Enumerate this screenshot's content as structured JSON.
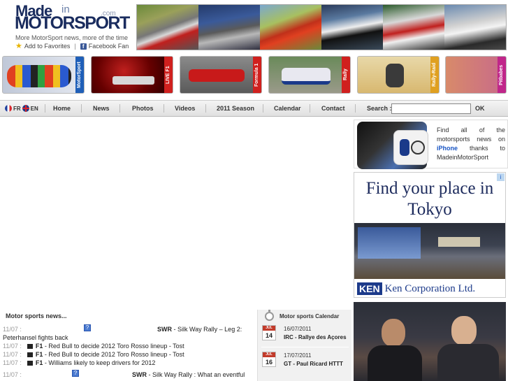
{
  "header": {
    "logo_made": "Made",
    "logo_in": "in",
    "logo_motorsport": "MOTORSPORT",
    "logo_com": ".com",
    "tagline": "More MotorSport news, more of the time",
    "add_favorites": "Add to Favorites",
    "facebook": "Facebook Fan"
  },
  "categories": [
    {
      "label": "MotorSport",
      "color": "#1f5fb8"
    },
    {
      "label": "LIVE F1",
      "color": "#d0201e"
    },
    {
      "label": "Formula 1",
      "color": "#d0201e"
    },
    {
      "label": "Rally",
      "color": "#d0201e"
    },
    {
      "label": "Rally-Raid",
      "color": "#e08a1c"
    },
    {
      "label": "Pitbabes",
      "color": "#c0268a"
    }
  ],
  "nav": {
    "lang_fr": "FR",
    "lang_en": "EN",
    "home": "Home",
    "news": "News",
    "photos": "Photos",
    "videos": "Videos",
    "season": "2011 Season",
    "calendar": "Calendar",
    "contact": "Contact",
    "search_label": "Search :",
    "search_value": "",
    "ok": "OK"
  },
  "iphone_promo": {
    "text_before": "Find all of the motorsports news on",
    "iphone": "iPhone",
    "text_after": "thanks to MadeinMotorSport"
  },
  "ken_ad": {
    "headline": "Find your place in Tokyo",
    "badge": "KEN",
    "company": "Ken Corporation Ltd.",
    "corner": "i"
  },
  "news": {
    "title": "Motor sports news...",
    "items": [
      {
        "date": "11/07 :",
        "cat": "SWR",
        "text": " - Silk Way Rally – Leg 2:",
        "second_line": "Peterhansel fights back",
        "icon": true
      },
      {
        "date": "11/07 :",
        "cat": "F1",
        "text": " - Red Bull to decide 2012 Toro Rosso lineup - Tost",
        "icon": false
      },
      {
        "date": "11/07 :",
        "cat": "F1",
        "text": " - Red Bull to decide 2012 Toro Rosso lineup - Tost",
        "icon": false
      },
      {
        "date": "11/07 :",
        "cat": "F1",
        "text": " - Williams likely to keep drivers for 2012",
        "icon": false
      },
      {
        "date": "11/07 :",
        "cat": "SWR",
        "text": " - Silk Way Rally : What an eventful",
        "icon": true
      }
    ]
  },
  "calendar": {
    "title": "Motor sports Calendar",
    "items": [
      {
        "month": "JUL",
        "day": "14",
        "date": "16/07/2011",
        "event": "IRC - Rallye des Açores"
      },
      {
        "month": "JUL",
        "day": "16",
        "date": "17/07/2011",
        "event": "GT - Paul Ricard HTTT"
      }
    ]
  }
}
